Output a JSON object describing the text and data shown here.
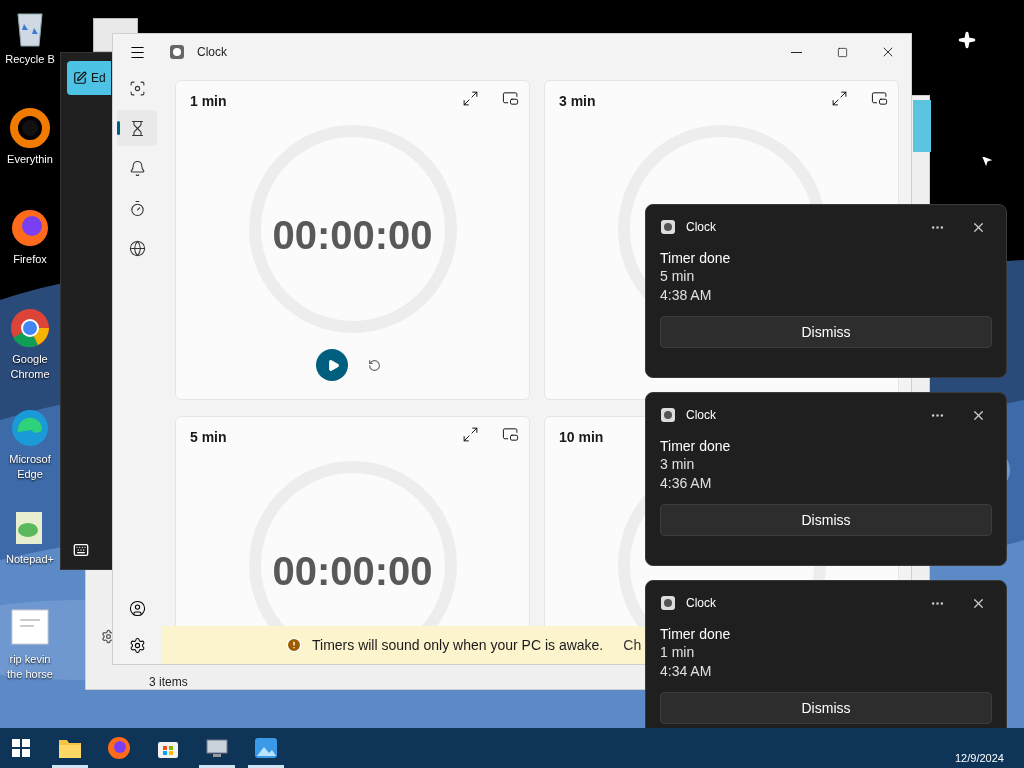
{
  "desktop_icons": [
    {
      "kind": "bin",
      "label": "Recycle B"
    },
    {
      "kind": "ring",
      "label": "Everythin"
    },
    {
      "kind": "fox",
      "label": "Firefox"
    },
    {
      "kind": "chrome",
      "label": "Google Chrome"
    },
    {
      "kind": "edge",
      "label": "Microsof Edge"
    },
    {
      "kind": "notepad",
      "label": "Notepad+"
    },
    {
      "kind": "file",
      "label": "rip kevin the horse"
    }
  ],
  "background_window": {
    "button": "Ed",
    "status": "3 items"
  },
  "clock_window": {
    "title": "Clock",
    "nav": [
      {
        "kind": "focus",
        "selected": false
      },
      {
        "kind": "timer",
        "selected": true
      },
      {
        "kind": "alarm",
        "selected": false
      },
      {
        "kind": "stopwatch",
        "selected": false
      },
      {
        "kind": "world",
        "selected": false
      }
    ],
    "timers": [
      {
        "label": "1 min",
        "time": "00:00:00",
        "controls": true,
        "view_buttons": true
      },
      {
        "label": "3 min",
        "view_buttons": true
      },
      {
        "label": "5 min",
        "time": "00:00:00",
        "view_buttons": true
      },
      {
        "label": "10 min"
      }
    ],
    "banner": {
      "message": "Timers will sound only when your PC is awake.",
      "action": "Ch"
    }
  },
  "notifications": [
    {
      "app": "Clock",
      "title": "Timer done",
      "name": "5 min",
      "time": "4:38 AM",
      "button": "Dismiss"
    },
    {
      "app": "Clock",
      "title": "Timer done",
      "name": "3 min",
      "time": "4:36 AM",
      "button": "Dismiss"
    },
    {
      "app": "Clock",
      "title": "Timer done",
      "name": "1 min",
      "time": "4:34 AM",
      "button": "Dismiss"
    }
  ],
  "taskbar": {
    "apps": [
      {
        "kind": "explorer",
        "running": true
      },
      {
        "kind": "firefox",
        "running": false
      },
      {
        "kind": "store",
        "running": false
      },
      {
        "kind": "monitor",
        "running": true
      },
      {
        "kind": "photos",
        "running": true
      }
    ],
    "date": "12/9/2024"
  }
}
